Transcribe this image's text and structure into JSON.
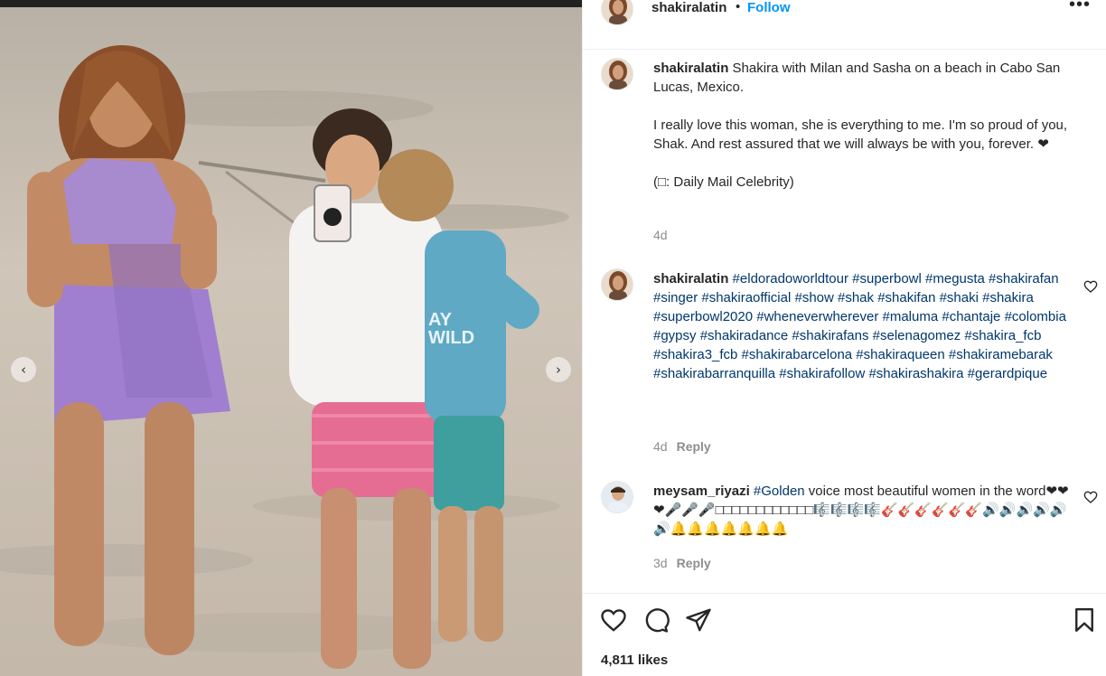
{
  "header": {
    "username": "shakiralatin",
    "separator": "•",
    "follow_label": "Follow",
    "more_label": "•••"
  },
  "caption": {
    "username": "shakiralatin",
    "text_line1": "Shakira with Milan and Sasha on a beach in Cabo San Lucas, Mexico.",
    "text_line2": "I really love this woman, she is everything to me. I'm so proud of you, Shak. And rest assured that we will always be with you, forever. ❤",
    "credit": "(□: Daily Mail Celebrity)",
    "age": "4d"
  },
  "comments": [
    {
      "username": "shakiralatin",
      "text": "#eldoradoworldtour #superbowl #megusta #shakirafan #singer #shakiraofficial #show #shak #shakifan #shaki #shakira #superbowl2020 #wheneverwherever #maluma #chantaje #colombia #gypsy #shakiradance #shakirafans #selenagomez #shakira_fcb #shakira3_fcb #shakirabarcelona #shakiraqueen #shakiramebarak #shakirabarranquilla #shakirafollow #shakirashakira #gerardpique",
      "age": "4d",
      "reply_label": "Reply"
    },
    {
      "username": "meysam_riyazi",
      "tag": "#Golden",
      "text": " voice most beautiful women in the word❤❤❤🎤🎤🎤□□□□□□□□□□□□🎼🎼🎼🎼🎸🎸🎸🎸🎸🎸🔊🔊🔊🔊🔊🔊🔔🔔🔔🔔🔔🔔🔔",
      "age": "3d",
      "reply_label": "Reply"
    }
  ],
  "footer": {
    "likes": "4,811 likes"
  },
  "icons": {
    "like": "heart-icon",
    "comment": "comment-bubble-icon",
    "share": "paper-plane-icon",
    "save": "bookmark-icon",
    "prev": "chevron-left-icon",
    "next": "chevron-right-icon"
  },
  "colors": {
    "link": "#0095f6",
    "hashtag": "#00376b",
    "muted": "#8e8e8e",
    "text": "#262626"
  },
  "navigation": {
    "prev_glyph": "‹",
    "next_glyph": "›"
  }
}
